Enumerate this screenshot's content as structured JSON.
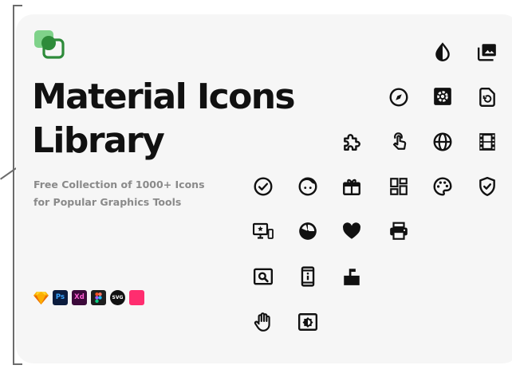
{
  "brand_colors": {
    "logo_green_dark": "#2e8b3a",
    "logo_green_light": "#7fd28a",
    "text_primary": "#111111",
    "text_secondary": "#8a8a8a",
    "card_background": "#f6f6f6"
  },
  "hero": {
    "title_line1": "Material Icons",
    "title_line2": "Library",
    "subtitle_line1": "Free Collection of 1000+ Icons",
    "subtitle_line2": "for Popular Graphics Tools"
  },
  "tool_badges": [
    {
      "name": "sketch-badge",
      "text": ""
    },
    {
      "name": "photoshop-badge",
      "text": "Ps"
    },
    {
      "name": "xd-badge",
      "text": "Xd"
    },
    {
      "name": "figma-badge",
      "text": ""
    },
    {
      "name": "svg-badge",
      "text": "SVG"
    },
    {
      "name": "pink-square-badge",
      "text": ""
    }
  ],
  "icons": [
    "invert-colors-icon",
    "photo-library-icon",
    "compass-icon",
    "settings-square-icon",
    "restore-page-icon",
    "extension-puzzle-icon",
    "touch-app-icon",
    "language-globe-icon",
    "movie-film-icon",
    "check-circle-icon",
    "face-icon",
    "gift-icon",
    "dashboard-icon",
    "palette-icon",
    "shield-check-icon",
    "desktop-star-icon",
    "pie-chart-icon",
    "favorite-heart-icon",
    "print-icon",
    "image-search-icon",
    "phone-info-icon",
    "mailbox-icon",
    "hand-pan-icon",
    "brightness-box-icon"
  ]
}
